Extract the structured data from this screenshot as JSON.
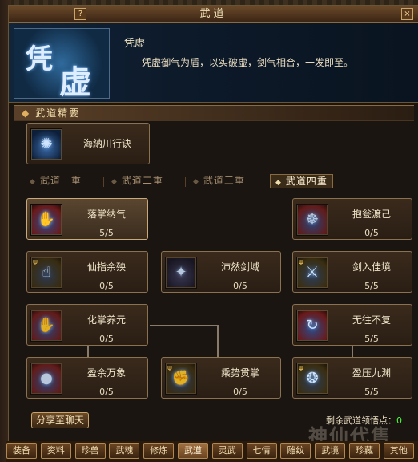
{
  "window": {
    "title": "武道",
    "help_label": "?",
    "close_label": "×"
  },
  "header": {
    "portrait_chars": [
      "凭",
      "虚"
    ],
    "skill_name": "凭虚",
    "skill_desc": "凭虚御气为盾，以实破虚，剑气相合，一发即至。"
  },
  "essence": {
    "section_title": "武道精要",
    "item": {
      "name": "海納川行诀",
      "icon": "swirl-icon"
    }
  },
  "tabs": [
    {
      "label": "武道一重",
      "active": false
    },
    {
      "label": "武道二重",
      "active": false
    },
    {
      "label": "武道三重",
      "active": false
    },
    {
      "label": "武道四重",
      "active": true
    }
  ],
  "skills": [
    {
      "name": "落掌纳气",
      "value": "5/5",
      "icon": "palm-icon",
      "selected": true
    },
    {
      "name": "抱瓮渡己",
      "value": "0/5",
      "icon": "jar-icon",
      "selected": false
    },
    {
      "name": "仙指余殃",
      "value": "0/5",
      "icon": "finger-icon",
      "selected": false
    },
    {
      "name": "沛然剑域",
      "value": "0/5",
      "icon": "sword-field-icon",
      "selected": false
    },
    {
      "name": "剑入佳境",
      "value": "5/5",
      "icon": "sword-icon",
      "selected": false
    },
    {
      "name": "化掌养元",
      "value": "0/5",
      "icon": "palm-icon",
      "selected": false
    },
    {
      "name": "无往不复",
      "value": "5/5",
      "icon": "return-icon",
      "selected": false
    },
    {
      "name": "盈余万象",
      "value": "0/5",
      "icon": "orb-icon",
      "selected": false
    },
    {
      "name": "乘势贯掌",
      "value": "0/5",
      "icon": "palm-strike-icon",
      "selected": false
    },
    {
      "name": "盈压九渊",
      "value": "5/5",
      "icon": "abyss-icon",
      "selected": false
    }
  ],
  "footer": {
    "share_label": "分享至聊天",
    "remain_label": "剩余武道领悟点：",
    "remain_value": "0"
  },
  "bottom_tabs": [
    "装备",
    "资料",
    "珍兽",
    "武魂",
    "修炼",
    "武道",
    "灵武",
    "七情",
    "雕纹",
    "武境",
    "珍藏",
    "其他"
  ],
  "bottom_tab_active": "武道",
  "watermark": "神仙代售"
}
